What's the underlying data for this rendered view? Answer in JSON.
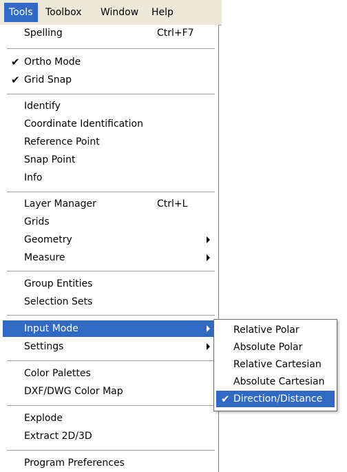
{
  "menubar": {
    "items": [
      {
        "label": "Tools",
        "active": true
      },
      {
        "label": "Toolbox"
      },
      {
        "label": "Window"
      },
      {
        "label": "Help"
      }
    ]
  },
  "tools_menu": {
    "items": [
      {
        "label": "Spelling",
        "shortcut": "Ctrl+F7"
      },
      {
        "label": "Ortho Mode",
        "checked": true
      },
      {
        "label": "Grid Snap",
        "checked": true
      },
      {
        "label": "Identify"
      },
      {
        "label": "Coordinate Identification"
      },
      {
        "label": "Reference Point"
      },
      {
        "label": "Snap Point"
      },
      {
        "label": "Info"
      },
      {
        "label": "Layer Manager",
        "shortcut": "Ctrl+L"
      },
      {
        "label": "Grids"
      },
      {
        "label": "Geometry",
        "has_submenu": true
      },
      {
        "label": "Measure",
        "has_submenu": true
      },
      {
        "label": "Group Entities"
      },
      {
        "label": "Selection Sets"
      },
      {
        "label": "Input Mode",
        "has_submenu": true,
        "highlighted": true
      },
      {
        "label": "Settings",
        "has_submenu": true
      },
      {
        "label": "Color Palettes"
      },
      {
        "label": "DXF/DWG Color Map"
      },
      {
        "label": "Explode"
      },
      {
        "label": "Extract 2D/3D"
      },
      {
        "label": "Program Preferences"
      }
    ],
    "check_glyph": "✔"
  },
  "input_mode_submenu": {
    "items": [
      {
        "label": "Relative Polar"
      },
      {
        "label": "Absolute Polar"
      },
      {
        "label": "Relative Cartesian"
      },
      {
        "label": "Absolute Cartesian"
      },
      {
        "label": "Direction/Distance",
        "checked": true,
        "highlighted": true
      }
    ]
  },
  "colors": {
    "highlight": "#316ac5",
    "menubar_background": "#ece9d8",
    "menu_background": "#ffffff"
  },
  "icons": {
    "check": "checkmark-icon",
    "submenu": "submenu-arrow-icon"
  }
}
